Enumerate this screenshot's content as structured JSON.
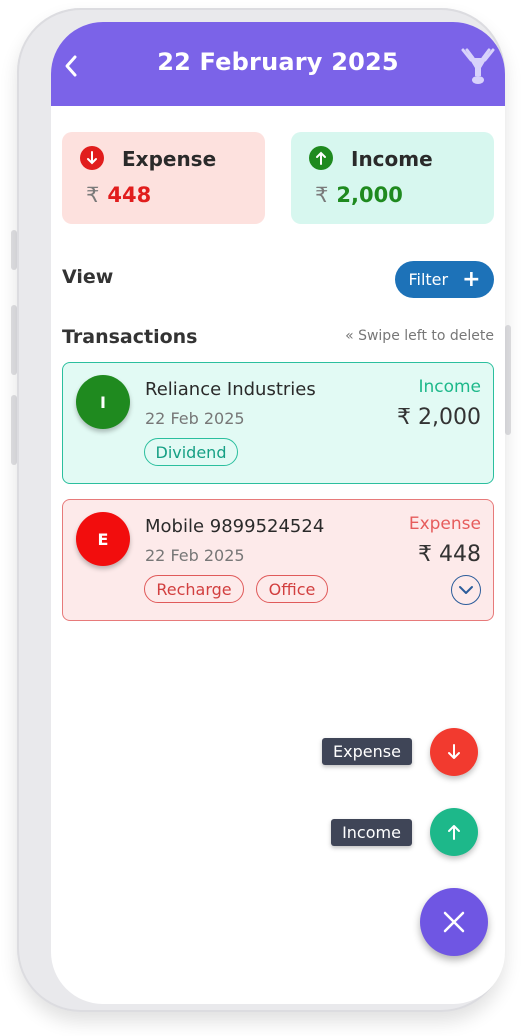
{
  "header": {
    "title": "22 February 2025"
  },
  "summary": {
    "expense": {
      "label": "Expense",
      "currency": "₹",
      "amount": "448",
      "color": "#e11d1d"
    },
    "income": {
      "label": "Income",
      "currency": "₹",
      "amount": "2,000",
      "color": "#1f8a1f"
    }
  },
  "view_label": "View",
  "filter_button": {
    "label": "Filter",
    "plus": "+"
  },
  "transactions_heading": "Transactions",
  "swipe_hint": "« Swipe left to delete",
  "transactions": [
    {
      "initial": "I",
      "name": "Reliance Industries",
      "date": "22 Feb 2025",
      "type": "Income",
      "amount": "₹ 2,000",
      "tags": [
        "Dividend"
      ]
    },
    {
      "initial": "E",
      "name": "Mobile 9899524524",
      "date": "22 Feb 2025",
      "type": "Expense",
      "amount": "₹ 448",
      "tags": [
        "Recharge",
        "Office"
      ]
    }
  ],
  "fab_actions": {
    "expense_label": "Expense",
    "income_label": "Income"
  },
  "colors": {
    "accent": "#7b63e8",
    "expense_red": "#f23a2f",
    "income_green": "#1db88a"
  }
}
